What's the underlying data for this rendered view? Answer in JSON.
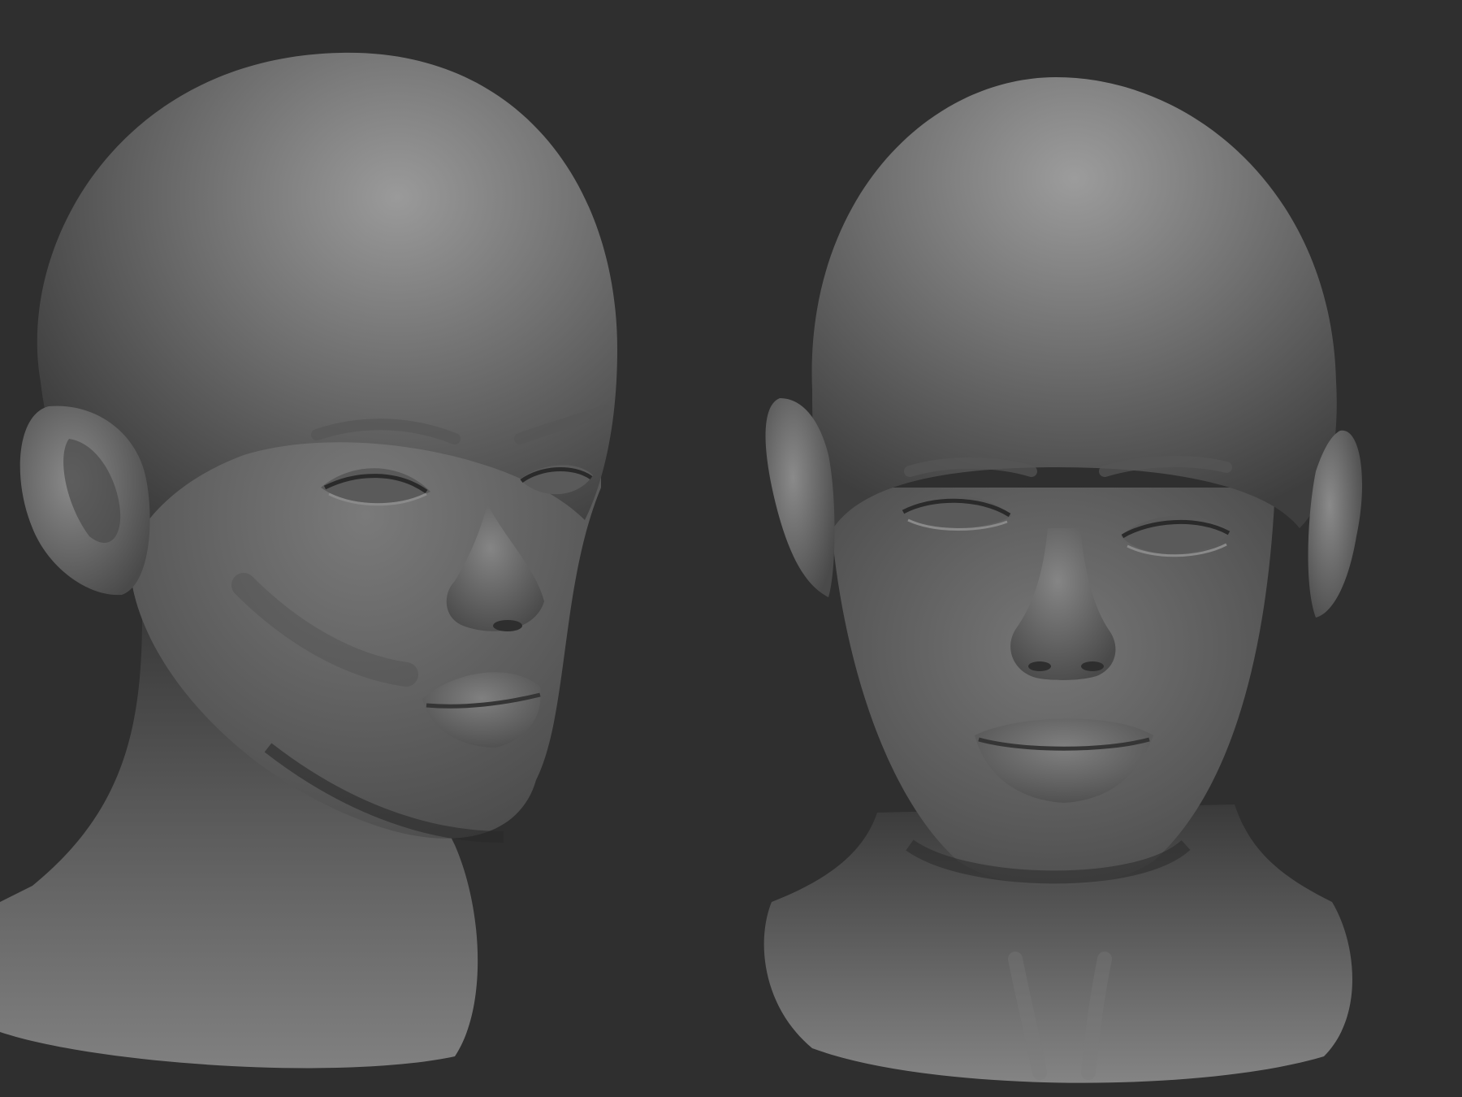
{
  "scene": {
    "background_color": "#2f2f2f",
    "material_color": "#6e6e6e",
    "highlight_color": "#9a9a9a",
    "shadow_color": "#1f1f1f",
    "subjects": [
      {
        "name": "head-sculpt-three-quarter",
        "view": "three-quarter"
      },
      {
        "name": "head-sculpt-front",
        "view": "front"
      }
    ]
  }
}
